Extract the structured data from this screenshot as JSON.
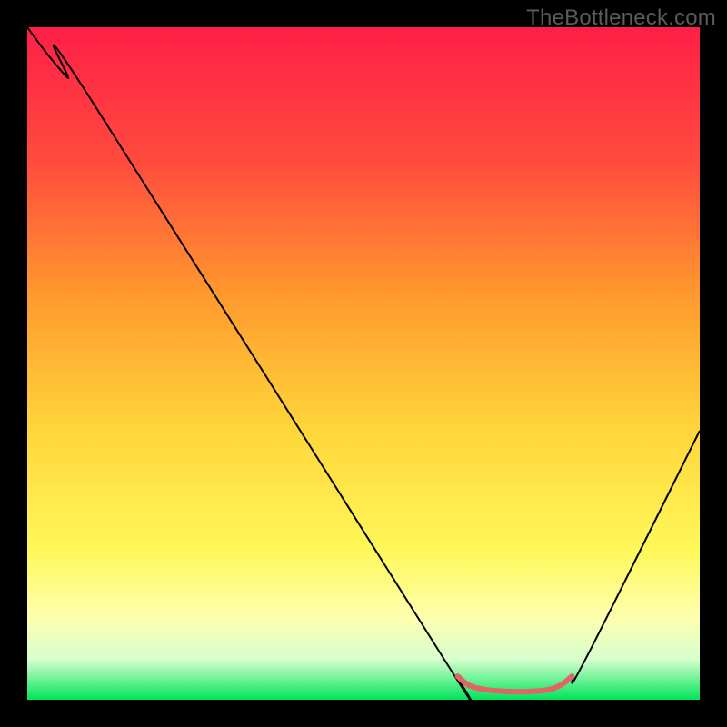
{
  "watermark": "TheBottleneck.com",
  "chart_data": {
    "type": "line",
    "title": "",
    "xlabel": "",
    "ylabel": "",
    "xlim": [
      0,
      100
    ],
    "ylim": [
      0,
      100
    ],
    "gradient_stops": [
      {
        "offset": 0,
        "color": "#ff1f47"
      },
      {
        "offset": 20,
        "color": "#ff4b3e"
      },
      {
        "offset": 40,
        "color": "#ff9a2e"
      },
      {
        "offset": 60,
        "color": "#ffd63a"
      },
      {
        "offset": 78,
        "color": "#fff85a"
      },
      {
        "offset": 88,
        "color": "#fdffb0"
      },
      {
        "offset": 94,
        "color": "#d7ffcf"
      },
      {
        "offset": 100,
        "color": "#00e55a"
      }
    ],
    "series": [
      {
        "name": "bottleneck-curve",
        "color": "#000000",
        "width": 2,
        "points": [
          {
            "x": 0,
            "y": 100
          },
          {
            "x": 3,
            "y": 96
          },
          {
            "x": 6,
            "y": 92.5
          },
          {
            "x": 9,
            "y": 90
          },
          {
            "x": 62,
            "y": 6
          },
          {
            "x": 64,
            "y": 3.5
          },
          {
            "x": 66,
            "y": 2
          },
          {
            "x": 70,
            "y": 1.3
          },
          {
            "x": 76,
            "y": 1.3
          },
          {
            "x": 79,
            "y": 2
          },
          {
            "x": 81,
            "y": 3.5
          },
          {
            "x": 83,
            "y": 6
          },
          {
            "x": 100,
            "y": 40
          }
        ]
      },
      {
        "name": "optimal-range-marker",
        "color": "#e06666",
        "width": 6,
        "linecap": "round",
        "points": [
          {
            "x": 64,
            "y": 3.5
          },
          {
            "x": 66,
            "y": 2
          },
          {
            "x": 70,
            "y": 1.3
          },
          {
            "x": 76,
            "y": 1.3
          },
          {
            "x": 79,
            "y": 2
          },
          {
            "x": 81,
            "y": 3.5
          }
        ]
      }
    ]
  }
}
